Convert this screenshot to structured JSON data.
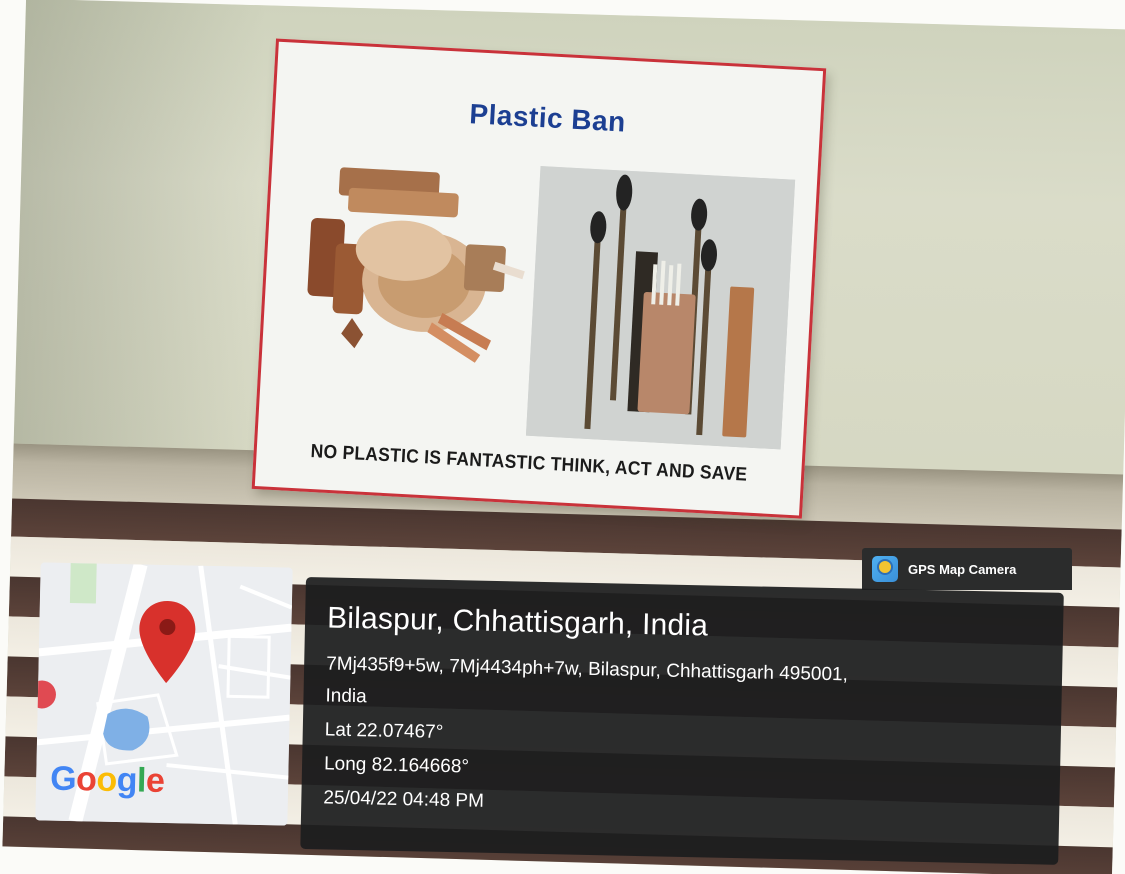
{
  "poster": {
    "title": "Plastic Ban",
    "slogan": "NO PLASTIC IS FANTASTIC THINK, ACT AND SAVE"
  },
  "gps_badge": {
    "label": "GPS Map Camera",
    "icon": "gps-map-camera-app-icon"
  },
  "map": {
    "brand": "Google",
    "pin_icon": "map-pin-icon",
    "colors": {
      "pin": "#d8312c",
      "water": "#7fb0e6",
      "road": "#ffffff",
      "land": "#eceef1"
    }
  },
  "location": {
    "city": "Bilaspur, Chhattisgarh, India",
    "address_line1": "7Mj435f9+5w, 7Mj4434ph+7w, Bilaspur, Chhattisgarh 495001,",
    "address_line2": "India",
    "lat": "Lat 22.07467°",
    "long": "Long 82.164668°",
    "datetime": "25/04/22 04:48 PM"
  },
  "colors": {
    "poster_border": "#c9323a",
    "poster_title": "#1c3f92",
    "panel_bg": "#1c1d1e",
    "google_blue": "#4285f4",
    "google_red": "#ea4335",
    "google_yellow": "#fbbc05",
    "google_green": "#34a853"
  }
}
